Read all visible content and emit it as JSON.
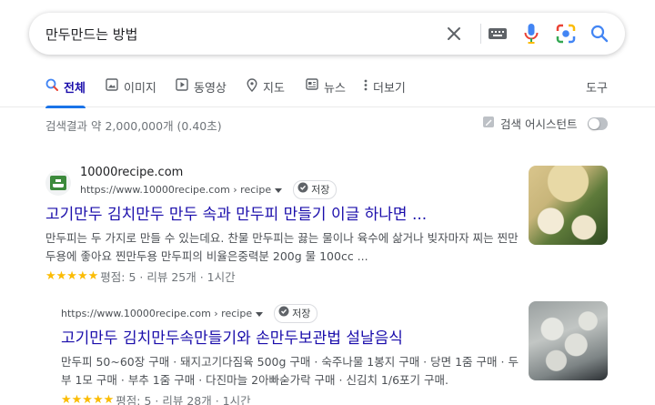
{
  "search": {
    "query": "만두만드는 방법"
  },
  "tabs": {
    "all": "전체",
    "images": "이미지",
    "videos": "동영상",
    "maps": "지도",
    "news": "뉴스",
    "more": "더보기",
    "tools": "도구"
  },
  "stats": "검색결과 약 2,000,000개 (0.40초)",
  "assistant_label": "검색 어시스턴트",
  "results": [
    {
      "site_name": "10000recipe.com",
      "url": "https://www.10000recipe.com › recipe",
      "save_label": "저장",
      "title": "고기만두 김치만두 만두 속과 만두피 만들기 이글 하나면 ...",
      "snippet": "만두피는 두 가지로 만들 수 있는데요. 찬물 만두피는 끓는 물이나 육수에 삶거나 빚자마자 찌는 찐만두용에 좋아요 찐만두용 만두피의 비율은중력분 200g 물 100cc ...",
      "stars": "★★★★★",
      "rating_text": "평점: 5 · 리뷰 25개 · 1시간"
    },
    {
      "url": "https://www.10000recipe.com › recipe",
      "save_label": "저장",
      "title": "고기만두 김치만두속만들기와 손만두보관법 설날음식",
      "snippet": "만두피 50~60장 구매 · 돼지고기다짐육 500g 구매 · 숙주나물 1봉지 구매 · 당면 1줌 구매 · 두부 1모 구매 · 부추 1줌 구매 · 다진마늘 2아빠숟가락 구매 · 신김치 1/6포기 구매.",
      "stars": "★★★★★",
      "rating_text": "평점: 5 · 리뷰 28개 · 1시간"
    }
  ],
  "colors": {
    "link": "#1a0dab",
    "accent": "#1a73e8",
    "star": "#fbbc04",
    "favicon": "#3c8a3c"
  },
  "icons": [
    "close-icon",
    "keyboard-icon",
    "mic-icon",
    "lens-icon",
    "search-icon",
    "image-icon",
    "video-icon",
    "map-pin-icon",
    "news-icon",
    "more-vert-icon",
    "save-icon",
    "caret-down-icon"
  ]
}
